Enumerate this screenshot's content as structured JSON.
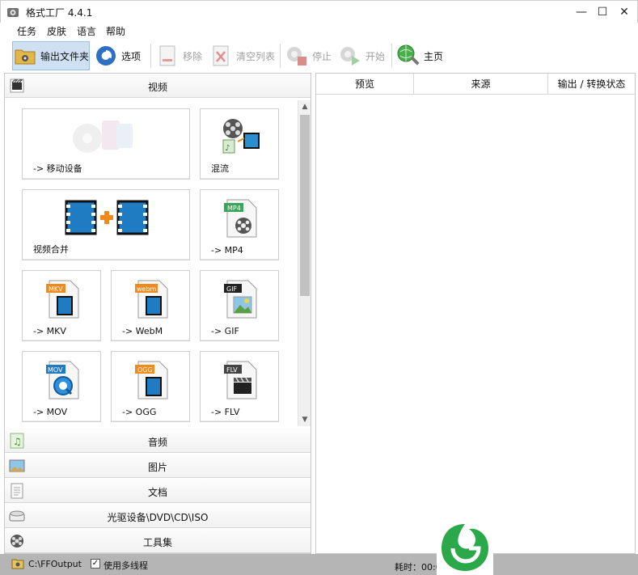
{
  "window": {
    "title": "格式工厂 4.4.1",
    "min": "—",
    "max": "☐",
    "close": "✕"
  },
  "menu": [
    "任务",
    "皮肤",
    "语言",
    "帮助"
  ],
  "toolbar": {
    "output_folder": "输出文件夹",
    "options": "选项",
    "remove": "移除",
    "clear_list": "清空列表",
    "stop": "停止",
    "start": "开始",
    "home": "主页"
  },
  "categories": {
    "video": "视频",
    "audio": "音频",
    "picture": "图片",
    "document": "文档",
    "optical": "光驱设备\\DVD\\CD\\ISO",
    "tools": "工具集"
  },
  "tiles": [
    {
      "label": "-> 移动设备",
      "icon": "mobile-device-icon"
    },
    {
      "label": "混流",
      "icon": "mux-icon"
    },
    {
      "label": "视频合并",
      "icon": "video-merge-icon"
    },
    {
      "label": "-> MP4",
      "icon": "mp4-file-icon",
      "badge": "MP4"
    },
    {
      "label": "-> MKV",
      "icon": "mkv-file-icon",
      "badge": "MKV"
    },
    {
      "label": "-> WebM",
      "icon": "webm-file-icon",
      "badge": "webm"
    },
    {
      "label": "-> GIF",
      "icon": "gif-file-icon",
      "badge": "GIF"
    },
    {
      "label": "-> MOV",
      "icon": "mov-file-icon",
      "badge": "MOV"
    },
    {
      "label": "-> OGG",
      "icon": "ogg-file-icon",
      "badge": "OGG"
    },
    {
      "label": "-> FLV",
      "icon": "flv-file-icon",
      "badge": "FLV"
    }
  ],
  "task_columns": [
    "预览",
    "来源",
    "输出 / 转换状态"
  ],
  "status": {
    "output_path": "C:\\FFOutput",
    "multithread": "使用多线程",
    "multithread_checked": true,
    "elapsed": "耗时：00:0"
  },
  "colors": {
    "accent": "#3c7fd0",
    "orange": "#f08a1c",
    "logo_green": "#2aa84a"
  }
}
